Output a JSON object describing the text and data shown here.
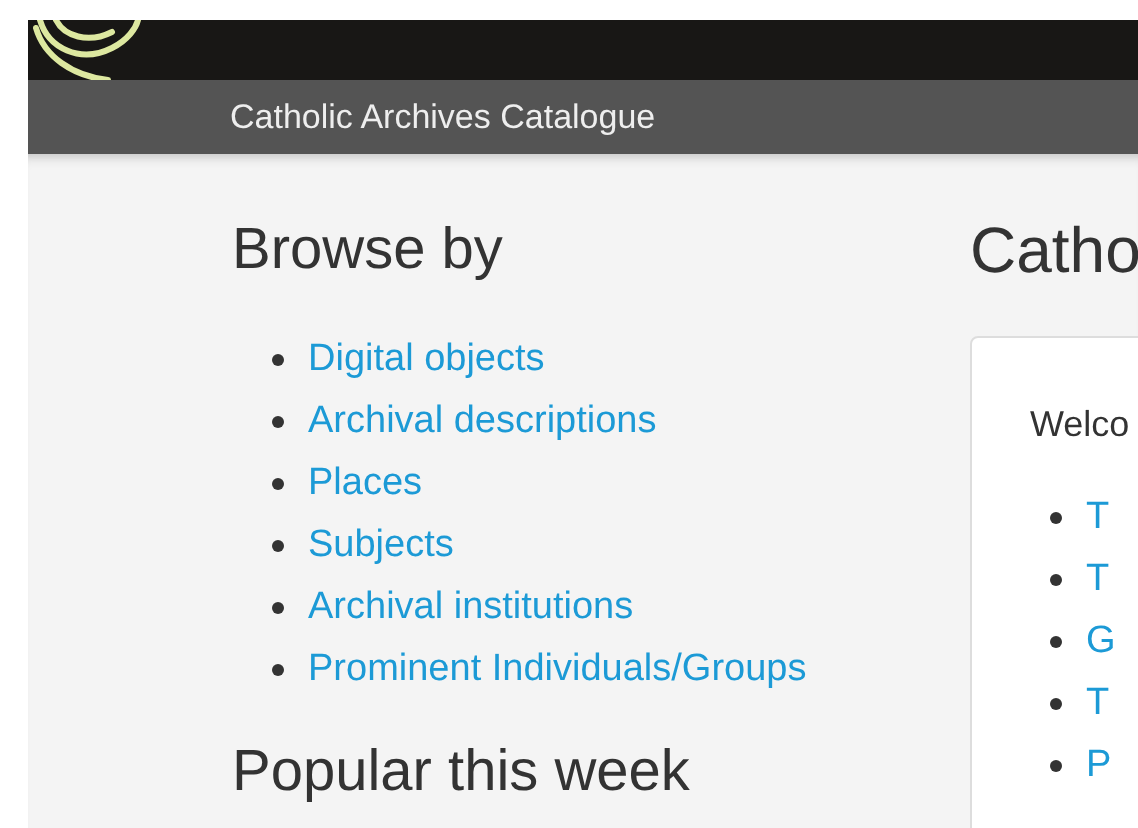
{
  "header": {
    "site_name": "Catholic Archives Catalogue"
  },
  "browse": {
    "title": "Browse by",
    "links": [
      {
        "label": "Digital objects"
      },
      {
        "label": "Archival descriptions"
      },
      {
        "label": "Places"
      },
      {
        "label": "Subjects"
      },
      {
        "label": "Archival institutions"
      },
      {
        "label": "Prominent Individuals/Groups"
      }
    ]
  },
  "popular": {
    "title": "Popular this week"
  },
  "main": {
    "title": "Catho",
    "intro": "Welco",
    "links": [
      {
        "label": "T"
      },
      {
        "label": "T"
      },
      {
        "label": "G"
      },
      {
        "label": "T"
      },
      {
        "label": "P"
      }
    ]
  }
}
